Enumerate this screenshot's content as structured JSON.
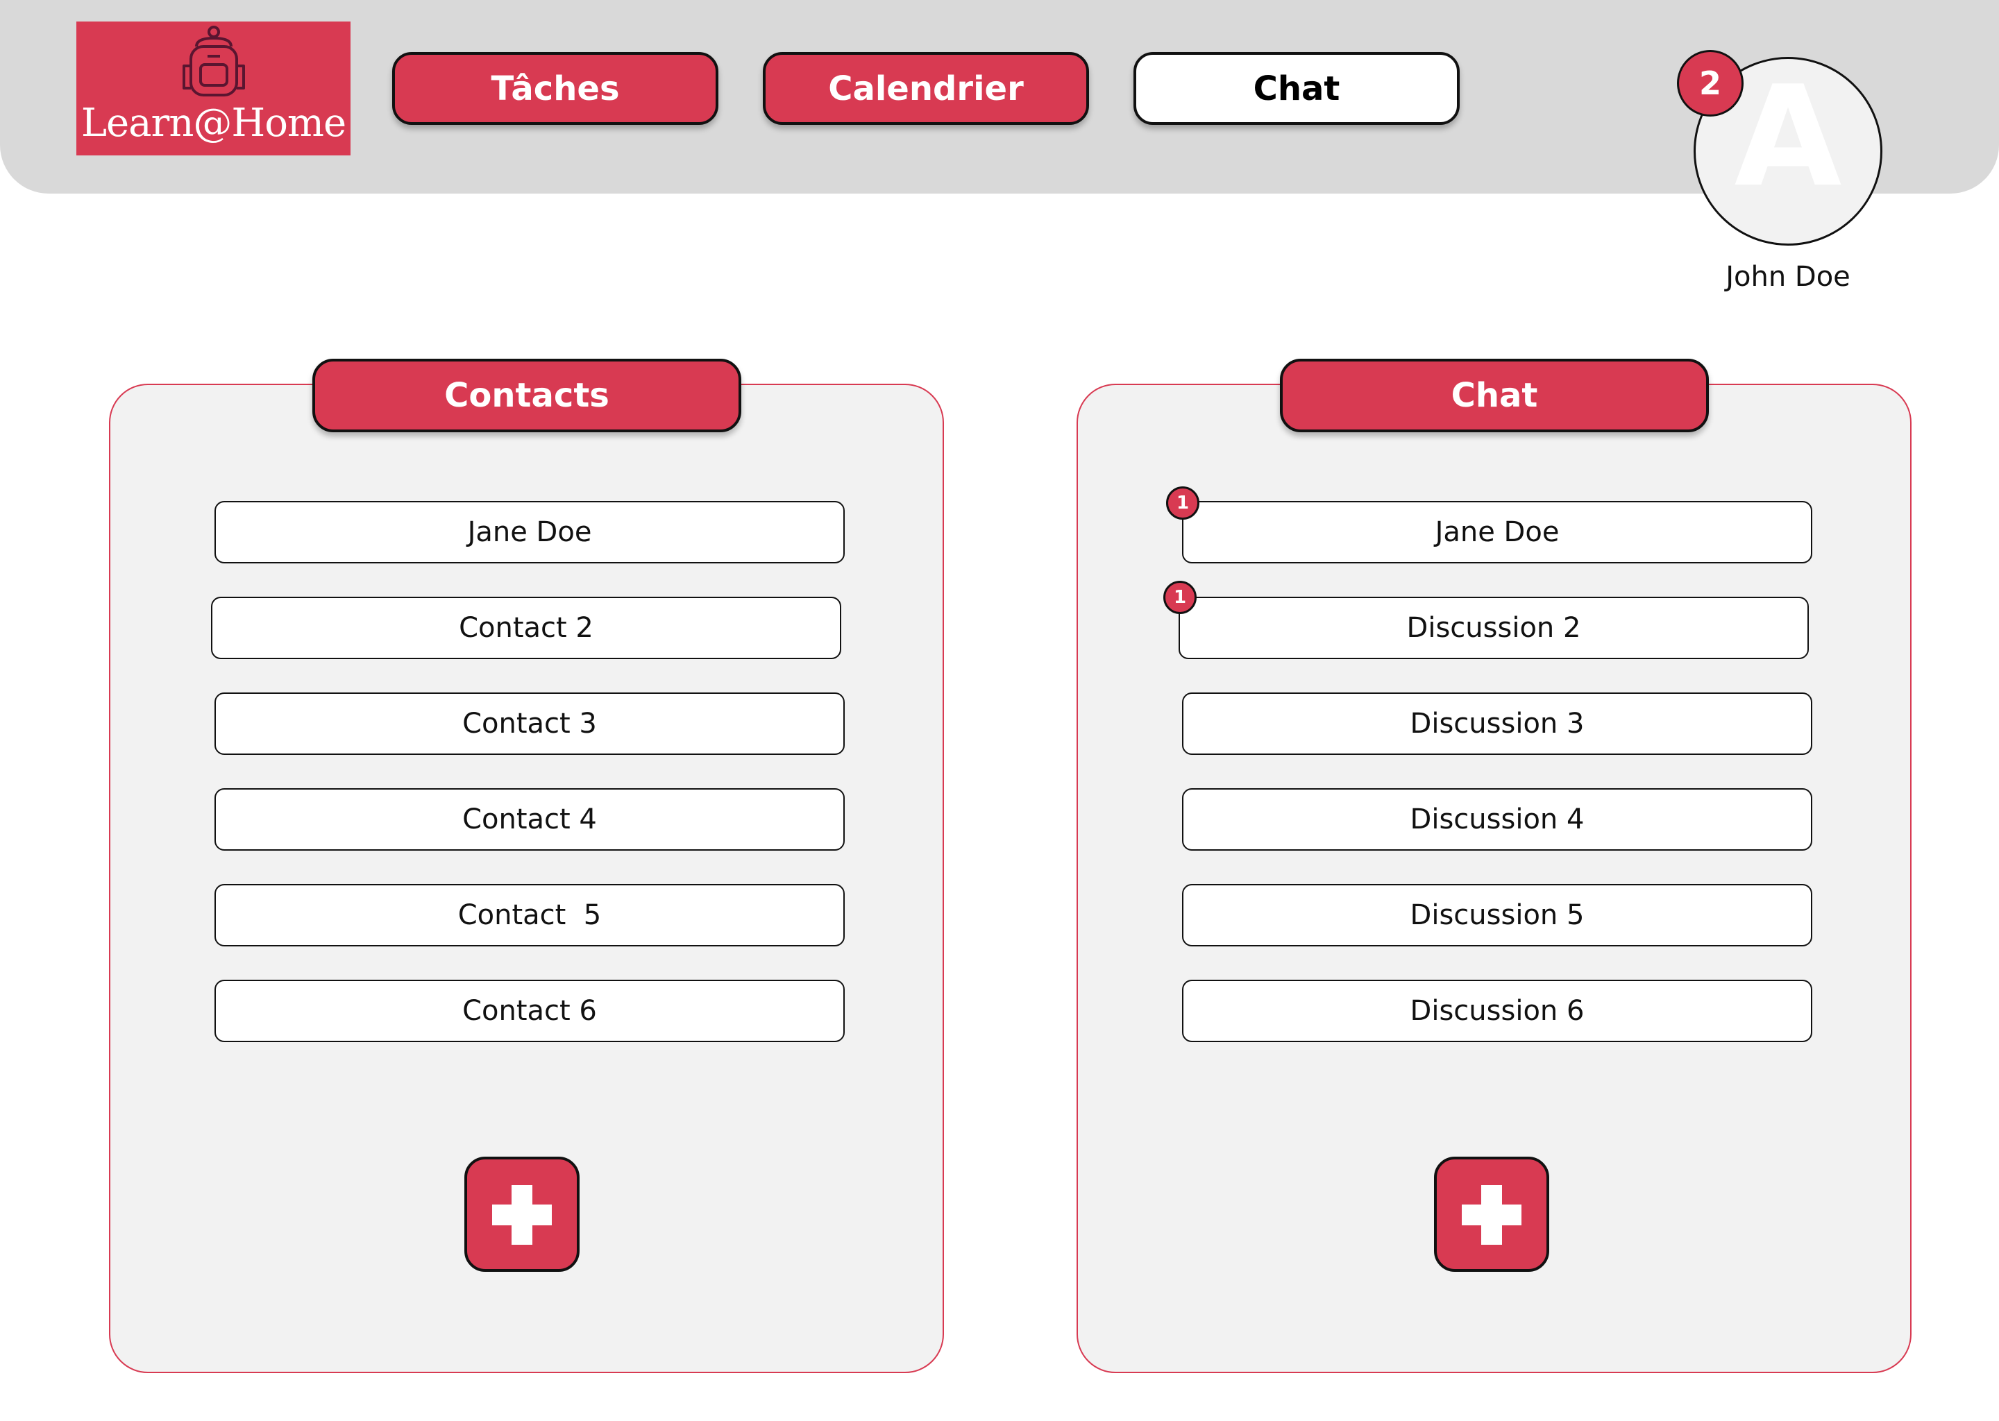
{
  "header": {
    "logo_text": "Learn@Home",
    "nav": [
      {
        "label": "Tâches",
        "active": false
      },
      {
        "label": "Calendrier",
        "active": false
      },
      {
        "label": "Chat",
        "active": true
      }
    ]
  },
  "user": {
    "initial": "A",
    "name": "John Doe",
    "notification_count": "2"
  },
  "contacts_panel": {
    "title": "Contacts",
    "items": [
      "Jane Doe",
      "Contact 2",
      "Contact 3",
      "Contact 4",
      "Contact  5",
      "Contact 6"
    ],
    "add_icon": "plus-icon"
  },
  "chat_panel": {
    "title": "Chat",
    "items": [
      {
        "label": "Jane Doe",
        "unread": "1"
      },
      {
        "label": "Discussion 2",
        "unread": "1"
      },
      {
        "label": "Discussion 3"
      },
      {
        "label": "Discussion 4"
      },
      {
        "label": "Discussion 5"
      },
      {
        "label": "Discussion 6"
      }
    ],
    "add_icon": "plus-icon"
  },
  "colors": {
    "accent": "#d83a52",
    "header_bg": "#d9d9d9",
    "panel_bg": "#f2f2f2"
  }
}
